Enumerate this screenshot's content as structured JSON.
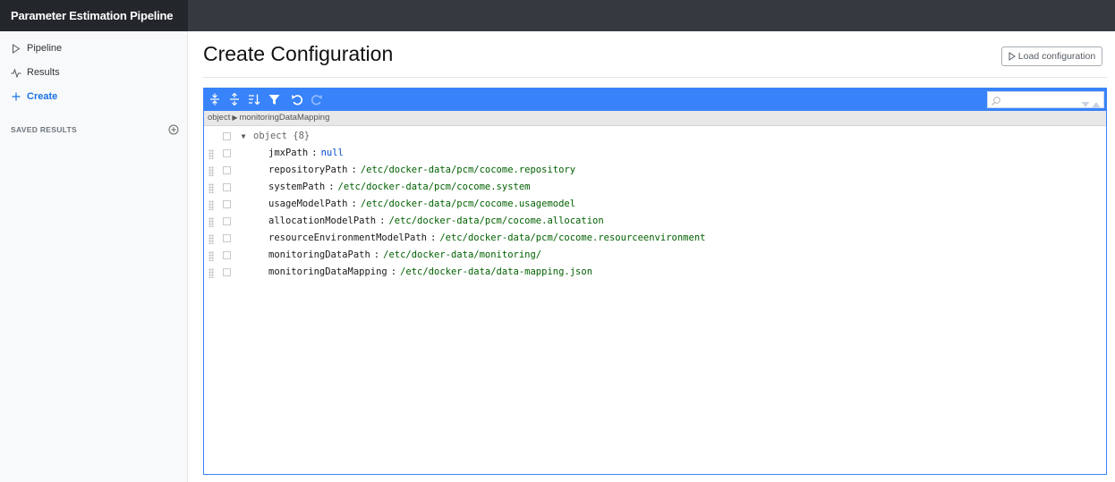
{
  "app": {
    "title": "Parameter Estimation Pipeline"
  },
  "sidebar": {
    "items": [
      {
        "label": "Pipeline",
        "icon": "play-outline-icon"
      },
      {
        "label": "Results",
        "icon": "activity-icon"
      },
      {
        "label": "Create",
        "icon": "plus-icon",
        "active": true
      }
    ],
    "saved_results_heading": "SAVED RESULTS"
  },
  "page": {
    "title": "Create Configuration",
    "load_button": "Load configuration"
  },
  "editor": {
    "search_placeholder": "",
    "breadcrumb": [
      "object",
      "monitoringDataMapping"
    ],
    "root_label": "object {8}",
    "fields": [
      {
        "key": "jmxPath",
        "value": "null",
        "type": "null"
      },
      {
        "key": "repositoryPath",
        "value": "/etc/docker-data/pcm/cocome.repository",
        "type": "string"
      },
      {
        "key": "systemPath",
        "value": "/etc/docker-data/pcm/cocome.system",
        "type": "string"
      },
      {
        "key": "usageModelPath",
        "value": "/etc/docker-data/pcm/cocome.usagemodel",
        "type": "string"
      },
      {
        "key": "allocationModelPath",
        "value": "/etc/docker-data/pcm/cocome.allocation",
        "type": "string"
      },
      {
        "key": "resourceEnvironmentModelPath",
        "value": "/etc/docker-data/pcm/cocome.resourceenvironment",
        "type": "string"
      },
      {
        "key": "monitoringDataPath",
        "value": "/etc/docker-data/monitoring/",
        "type": "string"
      },
      {
        "key": "monitoringDataMapping",
        "value": "/etc/docker-data/data-mapping.json",
        "type": "string"
      }
    ]
  },
  "colors": {
    "toolbar": "#3883fa",
    "active_nav": "#1a73e8",
    "string_value": "#006000",
    "null_value": "#004ed0"
  }
}
